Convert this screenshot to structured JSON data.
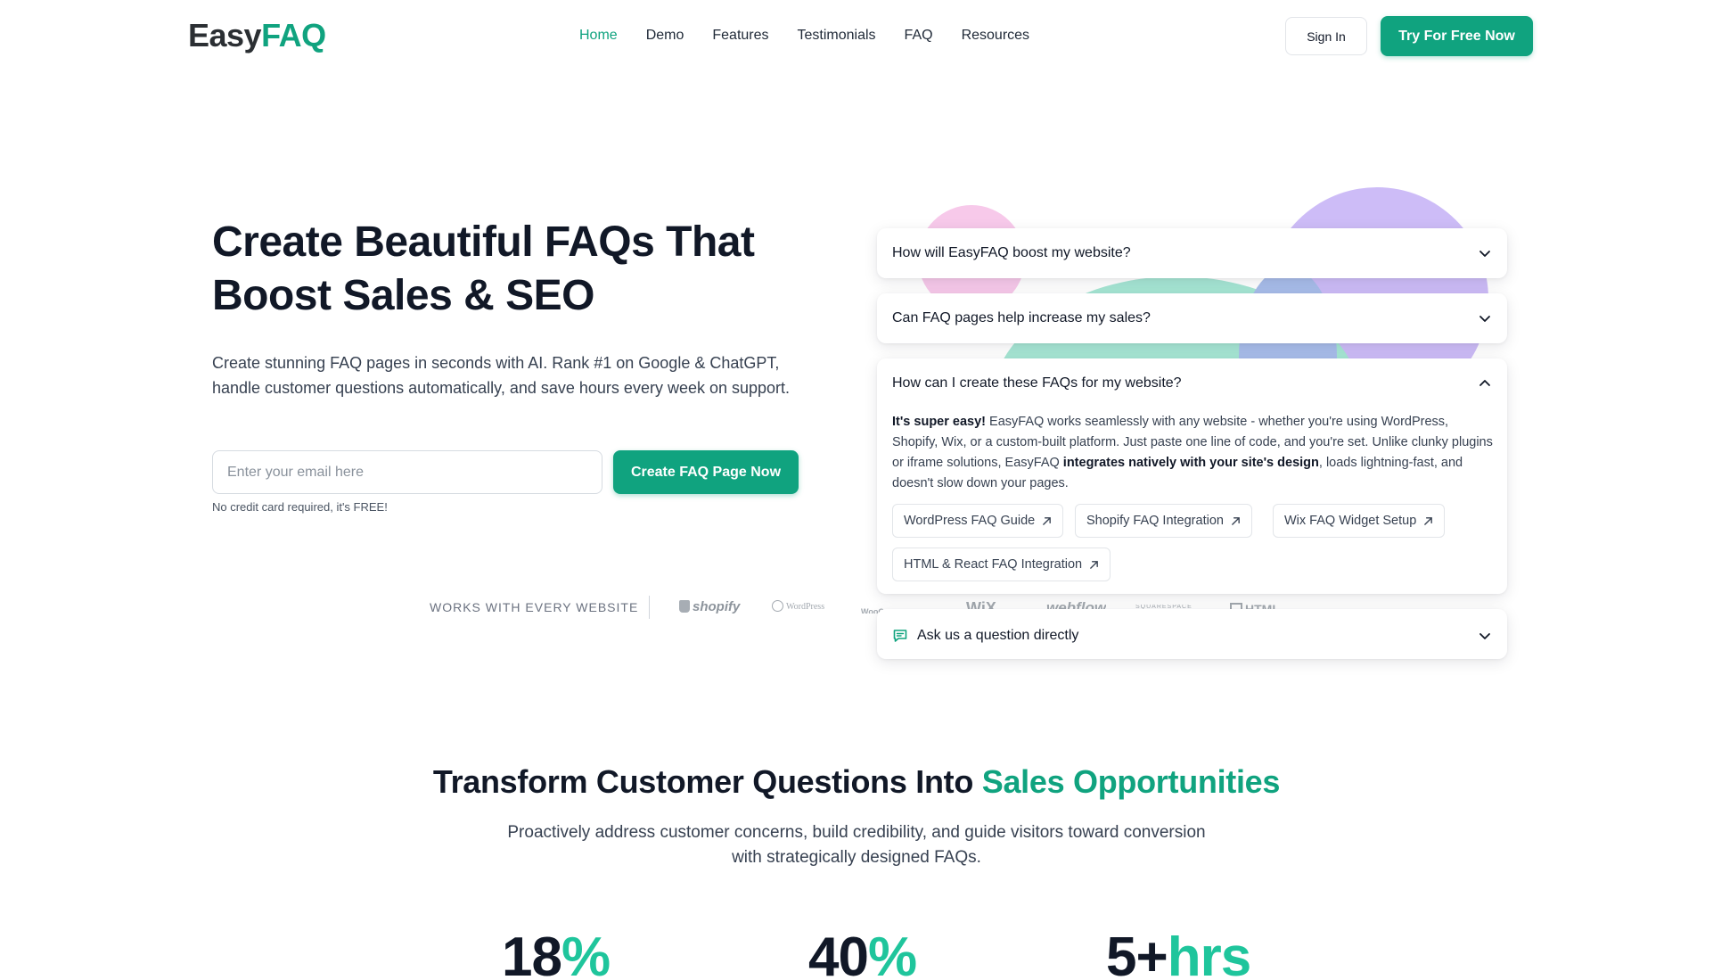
{
  "brand": {
    "logo_part1": "Easy",
    "logo_part2": "FAQ"
  },
  "nav": {
    "items": [
      {
        "label": "Home",
        "active": true
      },
      {
        "label": "Demo",
        "active": false
      },
      {
        "label": "Features",
        "active": false
      },
      {
        "label": "Testimonials",
        "active": false
      },
      {
        "label": "FAQ",
        "active": false
      },
      {
        "label": "Resources",
        "active": false
      }
    ],
    "sign_in": "Sign In",
    "cta": "Try For Free Now"
  },
  "hero": {
    "title_line1": "Create Beautiful FAQs That",
    "title_line2": "Boost Sales & SEO",
    "subtitle": "Create stunning FAQ pages in seconds with AI. Rank #1 on Google & ChatGPT, handle customer questions automatically, and save hours every week on support.",
    "email_placeholder": "Enter your email here",
    "cta": "Create FAQ Page Now",
    "note": "No credit card required, it's FREE!"
  },
  "works_with": {
    "label": "WORKS WITH EVERY WEBSITE",
    "platforms": [
      "shopify",
      "WordPress",
      "WooCommerce",
      "WiX",
      "webflow",
      "SQUARESPACE",
      "HTML"
    ]
  },
  "faq": {
    "items": [
      {
        "question": "How will EasyFAQ boost my website?",
        "expanded": false
      },
      {
        "question": "Can FAQ pages help increase my sales?",
        "expanded": false
      },
      {
        "question": "How can I create these FAQs for my website?",
        "expanded": true
      }
    ],
    "answer": {
      "lead_bold": "It's super easy!",
      "text1": " EasyFAQ works seamlessly with any website - whether you're using WordPress, Shopify, Wix, or a custom-built platform. Just paste one line of code, and you're set. Unlike clunky plugins or iframe solutions, EasyFAQ ",
      "mid_bold": "integrates natively with your site's design",
      "text2": ", loads lightning-fast, and doesn't slow down your pages."
    },
    "links": [
      "WordPress FAQ Guide",
      "Shopify FAQ Integration",
      "Wix FAQ Widget Setup",
      "HTML & React FAQ Integration"
    ],
    "ask": "Ask us a question directly"
  },
  "section2": {
    "title_plain": "Transform Customer Questions Into ",
    "title_accent": "Sales Opportunities",
    "subtitle": "Proactively address customer concerns, build credibility, and guide visitors toward conversion with strategically designed FAQs."
  },
  "stats": [
    {
      "number": "18",
      "unit": "%"
    },
    {
      "number": "40",
      "unit": "%"
    },
    {
      "number": "5+",
      "unit": "hrs"
    }
  ],
  "colors": {
    "accent": "#10a37f",
    "accent_light": "#1fc59c",
    "blob_pink": "#f7c9ea",
    "blob_mint": "#a6e6d4",
    "blob_blue": "#a8bdea",
    "blob_lavender": "#cdbcf7"
  }
}
